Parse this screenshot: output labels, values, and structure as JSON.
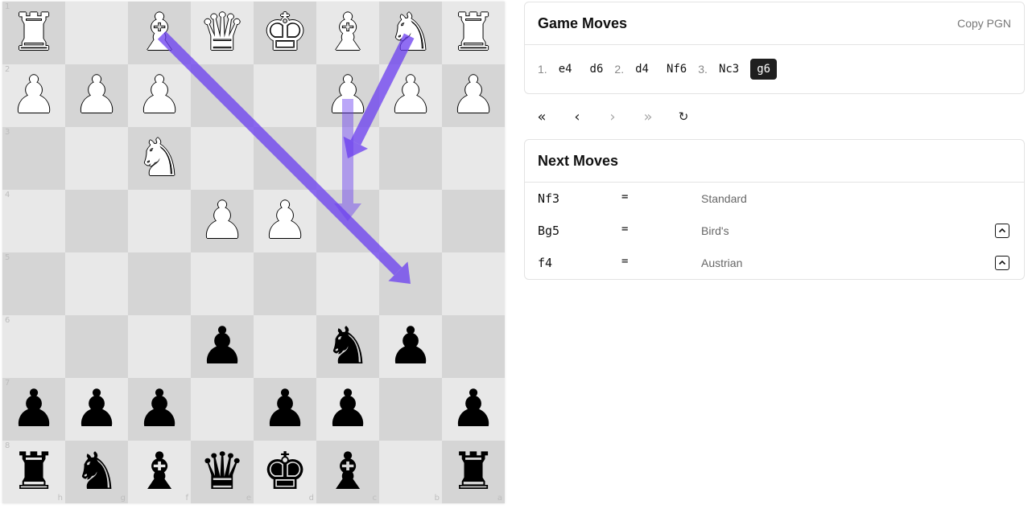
{
  "board": {
    "ranks": [
      "1",
      "2",
      "3",
      "4",
      "5",
      "6",
      "7",
      "8"
    ],
    "files": [
      "h",
      "g",
      "f",
      "e",
      "d",
      "c",
      "b",
      "a"
    ],
    "pieces": [
      {
        "square": "a1",
        "color": "w",
        "type": "rook",
        "glyph": "♜"
      },
      {
        "square": "b1",
        "color": "w",
        "type": "knight",
        "glyph": "♞"
      },
      {
        "square": "c1",
        "color": "w",
        "type": "bishop",
        "glyph": "♝"
      },
      {
        "square": "d1",
        "color": "w",
        "type": "king",
        "glyph": "♚"
      },
      {
        "square": "e1",
        "color": "w",
        "type": "queen",
        "glyph": "♛"
      },
      {
        "square": "f1",
        "color": "w",
        "type": "bishop",
        "glyph": "♝"
      },
      {
        "square": "h1",
        "color": "w",
        "type": "rook",
        "glyph": "♜"
      },
      {
        "square": "a2",
        "color": "w",
        "type": "pawn",
        "glyph": "♟"
      },
      {
        "square": "b2",
        "color": "w",
        "type": "pawn",
        "glyph": "♟"
      },
      {
        "square": "c2",
        "color": "w",
        "type": "pawn",
        "glyph": "♟"
      },
      {
        "square": "f2",
        "color": "w",
        "type": "pawn",
        "glyph": "♟"
      },
      {
        "square": "g2",
        "color": "w",
        "type": "pawn",
        "glyph": "♟"
      },
      {
        "square": "h2",
        "color": "w",
        "type": "pawn",
        "glyph": "♟"
      },
      {
        "square": "f3",
        "color": "w",
        "type": "knight",
        "glyph": "♞"
      },
      {
        "square": "d4",
        "color": "w",
        "type": "pawn",
        "glyph": "♟"
      },
      {
        "square": "e4",
        "color": "w",
        "type": "pawn",
        "glyph": "♟"
      },
      {
        "square": "b6",
        "color": "b",
        "type": "pawn",
        "glyph": "♟"
      },
      {
        "square": "c6",
        "color": "b",
        "type": "knight",
        "glyph": "♞"
      },
      {
        "square": "e6",
        "color": "b",
        "type": "pawn",
        "glyph": "♟"
      },
      {
        "square": "a7",
        "color": "b",
        "type": "pawn",
        "glyph": "♟"
      },
      {
        "square": "c7",
        "color": "b",
        "type": "pawn",
        "glyph": "♟"
      },
      {
        "square": "d7",
        "color": "b",
        "type": "pawn",
        "glyph": "♟"
      },
      {
        "square": "f7",
        "color": "b",
        "type": "pawn",
        "glyph": "♟"
      },
      {
        "square": "g7",
        "color": "b",
        "type": "pawn",
        "glyph": "♟"
      },
      {
        "square": "h7",
        "color": "b",
        "type": "pawn",
        "glyph": "♟"
      },
      {
        "square": "a8",
        "color": "b",
        "type": "rook",
        "glyph": "♜"
      },
      {
        "square": "c8",
        "color": "b",
        "type": "bishop",
        "glyph": "♝"
      },
      {
        "square": "d8",
        "color": "b",
        "type": "king",
        "glyph": "♚"
      },
      {
        "square": "e8",
        "color": "b",
        "type": "queen",
        "glyph": "♛"
      },
      {
        "square": "f8",
        "color": "b",
        "type": "bishop",
        "glyph": "♝"
      },
      {
        "square": "g8",
        "color": "b",
        "type": "knight",
        "glyph": "♞"
      },
      {
        "square": "h8",
        "color": "b",
        "type": "rook",
        "glyph": "♜"
      }
    ],
    "arrows": [
      {
        "from": "b1",
        "to": "c3",
        "opacity": 0.75
      },
      {
        "from": "c2",
        "to": "c4",
        "opacity": 0.45
      },
      {
        "from": "f1",
        "to": "b5",
        "opacity": 0.75
      }
    ],
    "arrow_color": "#6a3df0"
  },
  "game_moves": {
    "title": "Game Moves",
    "copy_label": "Copy PGN",
    "moves": [
      {
        "num": "1.",
        "white": "e4",
        "black": "d6"
      },
      {
        "num": "2.",
        "white": "d4",
        "black": "Nf6"
      },
      {
        "num": "3.",
        "white": "Nc3",
        "black": "g6"
      }
    ],
    "current": "g6"
  },
  "nav": {
    "first": "«",
    "prev": "‹",
    "next": "›",
    "last": "»",
    "flip": "↻"
  },
  "next_moves": {
    "title": "Next Moves",
    "items": [
      {
        "move": "Nf3",
        "eval": "=",
        "name": "Standard",
        "expandable": false
      },
      {
        "move": "Bg5",
        "eval": "=",
        "name": "Bird's",
        "expandable": true
      },
      {
        "move": "f4",
        "eval": "=",
        "name": "Austrian",
        "expandable": true
      }
    ]
  }
}
